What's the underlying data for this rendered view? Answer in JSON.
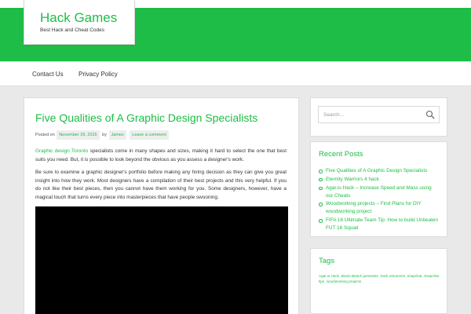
{
  "site": {
    "title": "Hack Games",
    "description": "Best Hack and Cheat Codes"
  },
  "nav": {
    "items": [
      {
        "label": "Contact Us"
      },
      {
        "label": "Privacy Policy"
      }
    ]
  },
  "post": {
    "title": "Five Qualities of A Graphic Design Specialists",
    "meta": {
      "posted_on": "Posted on",
      "date": "November 29, 2015",
      "by": "by",
      "author": "James",
      "comment_link": "Leave a comment"
    },
    "paragraph1": {
      "link1": "Graphic design",
      "link2": "Toronto",
      "text": " specialists come in many shapes and sizes, making it hard to select the one that best suits you need. But, it is possible to look beyond the obvious as you assess a designer's work."
    },
    "paragraph2": "Be sure to examine a graphic designer's portfolio before making any hiring decision as they can give you great insight into how they work. Most designers have a compilation of their best projects and this very helpful. If you do not like their best pieces, then you cannot have them working for you. Some designers, however, have a magical touch that turns every piece into masterpieces that have people swooning."
  },
  "sidebar": {
    "search": {
      "placeholder": "Search..."
    },
    "recent": {
      "title": "Recent Posts",
      "items": [
        "Five Qualities of A Graphic Design Specialists",
        "Eternity Warriors 4 hack",
        "Agar.io Hack – Increase Speed and Mass using our Cheats",
        "Woodworking projects – Find Plans for DIY woodworking project",
        "FIFA 16 Ultimate Team Tip: How to build Unbeaten FUT 16 Squad"
      ]
    },
    "tags": {
      "title": "Tags",
      "items": [
        "Agar.io Hack",
        "Boom Beach generator",
        "hack resources",
        "snapchat",
        "snapchat tips",
        "woodworking projects"
      ]
    }
  },
  "colors": {
    "accent": "#1ebd47",
    "background": "#e9e9e9",
    "video": "#000000"
  }
}
